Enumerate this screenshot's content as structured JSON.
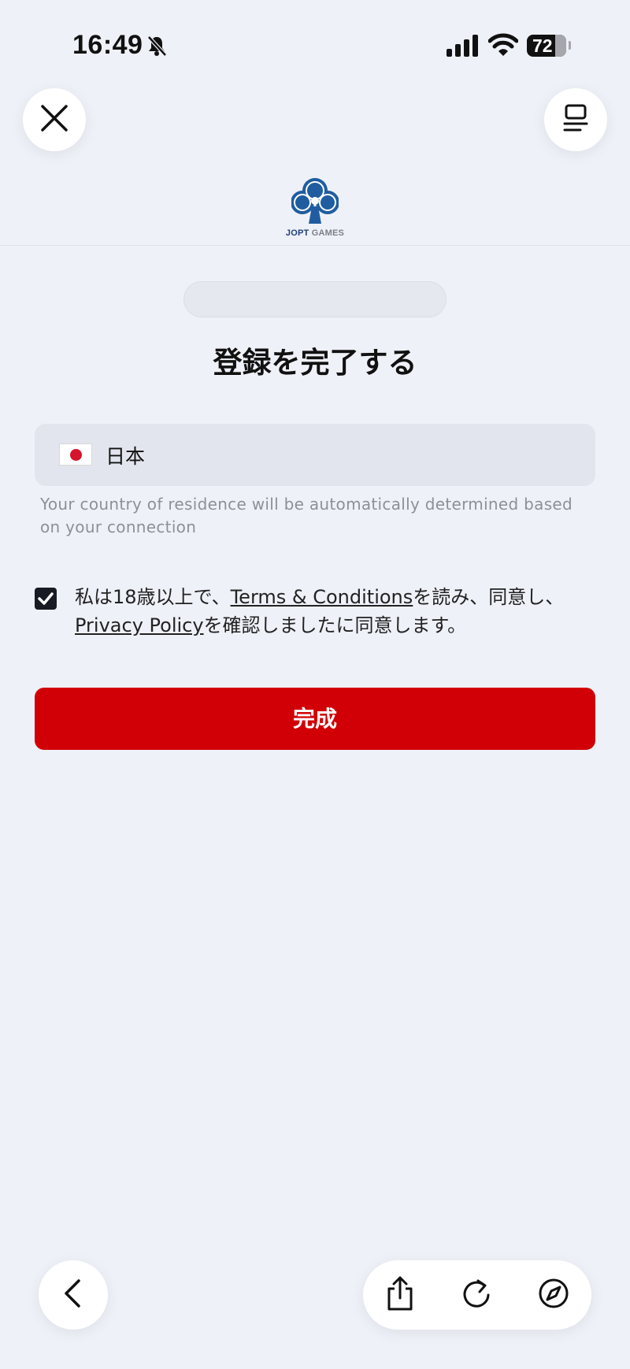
{
  "status_bar": {
    "time": "16:49",
    "battery": "72"
  },
  "brand": {
    "name_part1": "JOPT",
    "name_part2": "GAMES",
    "logo_color": "#1f5da0"
  },
  "form": {
    "title": "登録を完了する",
    "country": {
      "value": "日本",
      "flag": "japan-flag"
    },
    "hint": "Your country of residence will be automatically determined based on your connection",
    "agreement": {
      "checked": true,
      "text_1": "私は18歳以上で、",
      "terms_link": "Terms & Conditions",
      "text_2": "を読み、同意し、",
      "privacy_link": "Privacy Policy",
      "text_3": "を確認しましたに同意します。"
    },
    "submit_label": "完成"
  },
  "colors": {
    "accent": "#d10006",
    "background": "#eff1f8",
    "field": "#e3e5ee"
  },
  "toolbar": {
    "icons": [
      "back-icon",
      "share-icon",
      "reload-icon",
      "compass-icon"
    ]
  }
}
